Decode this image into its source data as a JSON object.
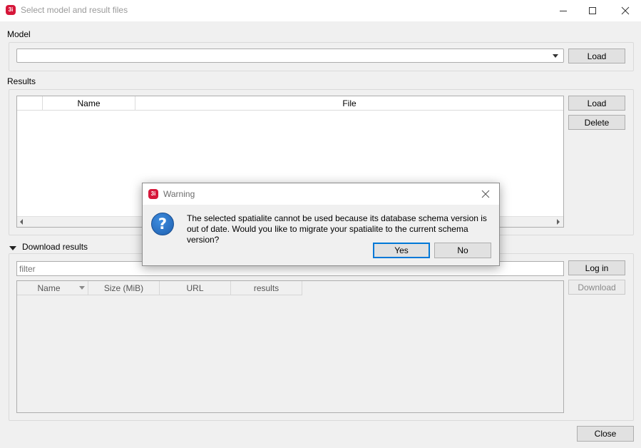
{
  "window": {
    "title": "Select model and result files",
    "logo_text": "3i"
  },
  "model": {
    "section_label": "Model",
    "combo_value": "",
    "load_label": "Load"
  },
  "results": {
    "section_label": "Results",
    "columns": [
      "",
      "Name",
      "File"
    ],
    "load_label": "Load",
    "delete_label": "Delete"
  },
  "download": {
    "section_label": "Download results",
    "filter_placeholder": "filter",
    "login_label": "Log in",
    "download_label": "Download",
    "columns": [
      "Name",
      "Size (MiB)",
      "URL",
      "results"
    ]
  },
  "footer": {
    "close_label": "Close"
  },
  "dialog": {
    "title": "Warning",
    "message": "The selected spatialite cannot be used because its database schema version is out of date. Would you like to migrate your spatialite to the current schema version?",
    "yes_label": "Yes",
    "no_label": "No",
    "icon": "question-icon"
  }
}
